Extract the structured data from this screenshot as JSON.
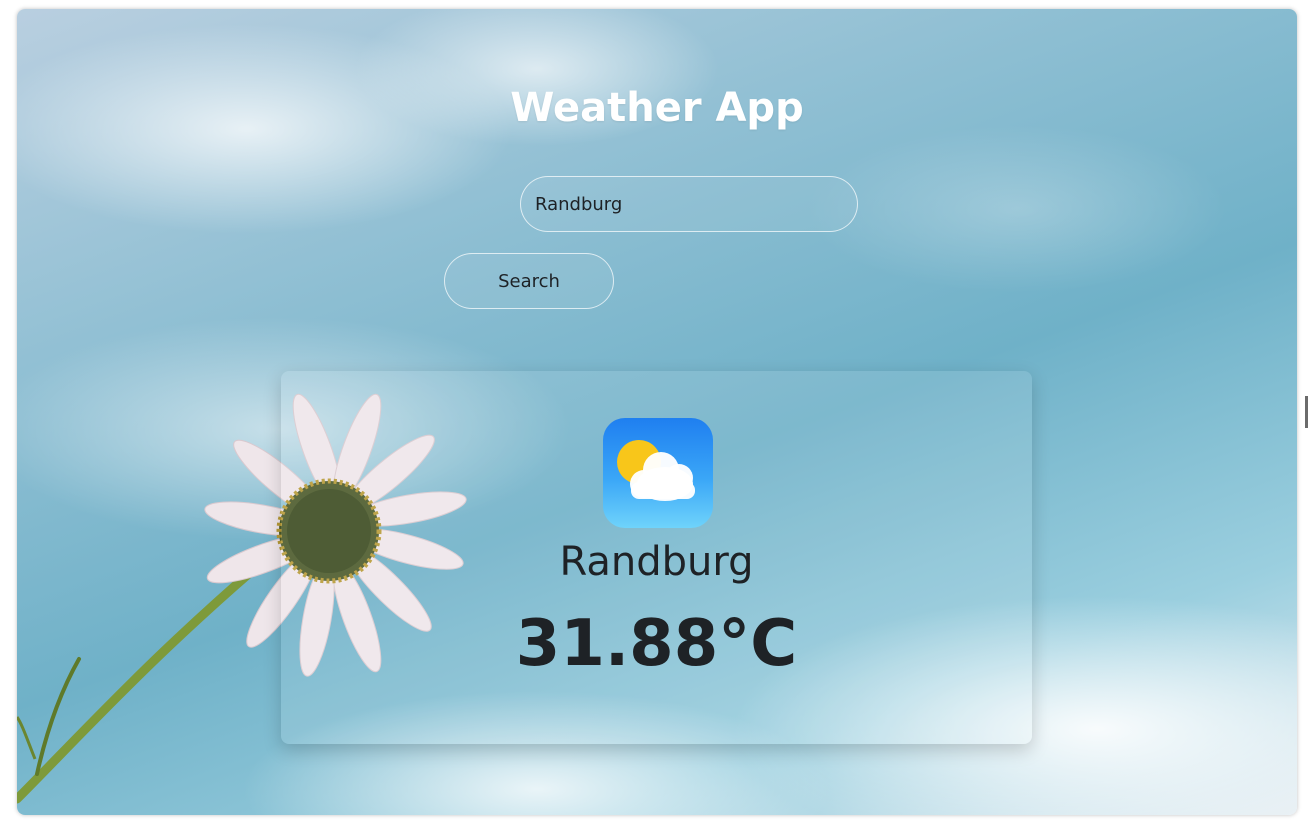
{
  "app": {
    "title": "Weather App"
  },
  "search": {
    "value": "Randburg",
    "placeholder": "",
    "button_label": "Search"
  },
  "weather": {
    "city": "Randburg",
    "temperature": "31.88°C",
    "icon": "partly-cloudy-icon"
  },
  "colors": {
    "text_dark": "#1e2226",
    "title_white": "#ffffff",
    "icon_blue_top": "#1f7ff0",
    "icon_blue_bottom": "#6fd3fb",
    "sun_yellow": "#f8c61a"
  }
}
